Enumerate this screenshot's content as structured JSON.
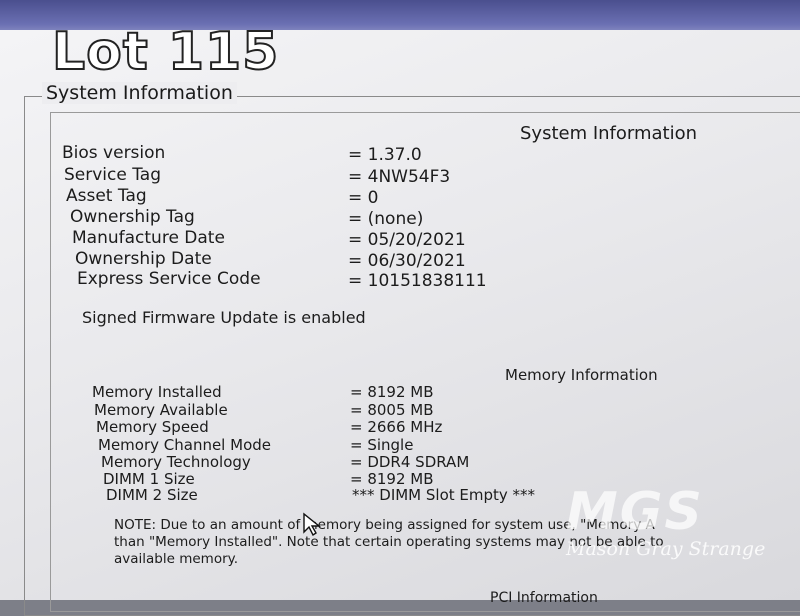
{
  "overlay": {
    "lot": "Lot 115"
  },
  "group_title": "System Information",
  "system": {
    "heading": "System Information",
    "rows": [
      {
        "label": "Bios version",
        "value": "= 1.37.0"
      },
      {
        "label": "Service Tag",
        "value": "= 4NW54F3"
      },
      {
        "label": "Asset Tag",
        "value": "= 0"
      },
      {
        "label": "Ownership Tag",
        "value": "= (none)"
      },
      {
        "label": "Manufacture Date",
        "value": "= 05/20/2021"
      },
      {
        "label": "Ownership Date",
        "value": "= 06/30/2021"
      },
      {
        "label": "Express Service Code",
        "value": "= 10151838111"
      }
    ],
    "firmware_status": "Signed Firmware Update is enabled"
  },
  "memory": {
    "heading": "Memory Information",
    "rows": [
      {
        "label": "Memory Installed",
        "value": "= 8192 MB"
      },
      {
        "label": "Memory Available",
        "value": "= 8005 MB"
      },
      {
        "label": "Memory Speed",
        "value": "= 2666 MHz"
      },
      {
        "label": "Memory Channel Mode",
        "value": "= Single"
      },
      {
        "label": "Memory Technology",
        "value": "= DDR4 SDRAM"
      },
      {
        "label": "DIMM 1 Size",
        "value": "= 8192 MB"
      },
      {
        "label": "DIMM 2 Size",
        "value": "*** DIMM Slot Empty ***"
      }
    ],
    "note_line1": "NOTE: Due to an amount of memory being assigned for system use, \"Memory A",
    "note_line2": "than \"Memory Installed\". Note that certain operating systems may not be able to",
    "note_line3": "available memory."
  },
  "pci": {
    "heading": "PCI Information"
  },
  "watermark": {
    "logo": "MGS",
    "name": "Mason Gray Strange"
  }
}
